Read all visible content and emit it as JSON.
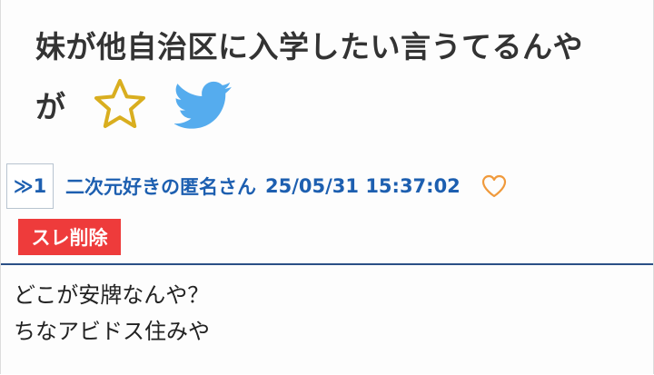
{
  "thread": {
    "title_line1": "妹が他自治区に入学したい言うてるんや",
    "title_line2": "が"
  },
  "icons": {
    "favorite": "star-outline-icon",
    "share": "twitter-bird-icon",
    "like": "heart-outline-icon"
  },
  "post": {
    "number": "≫1",
    "poster_name": "二次元好きの匿名さん",
    "datetime": "25/05/31 15:37:02",
    "delete_label": "スレ削除",
    "body_line1": "どこが安牌なんや？",
    "body_line2": "ちなアビドス住みや"
  },
  "colors": {
    "link_blue": "#1d5fb0",
    "delete_red": "#ee3b3b",
    "star_gold": "#d9ae1f",
    "twitter_blue": "#55acee",
    "heart_orange": "#f09a3c",
    "divider_navy": "#2b4f86"
  }
}
